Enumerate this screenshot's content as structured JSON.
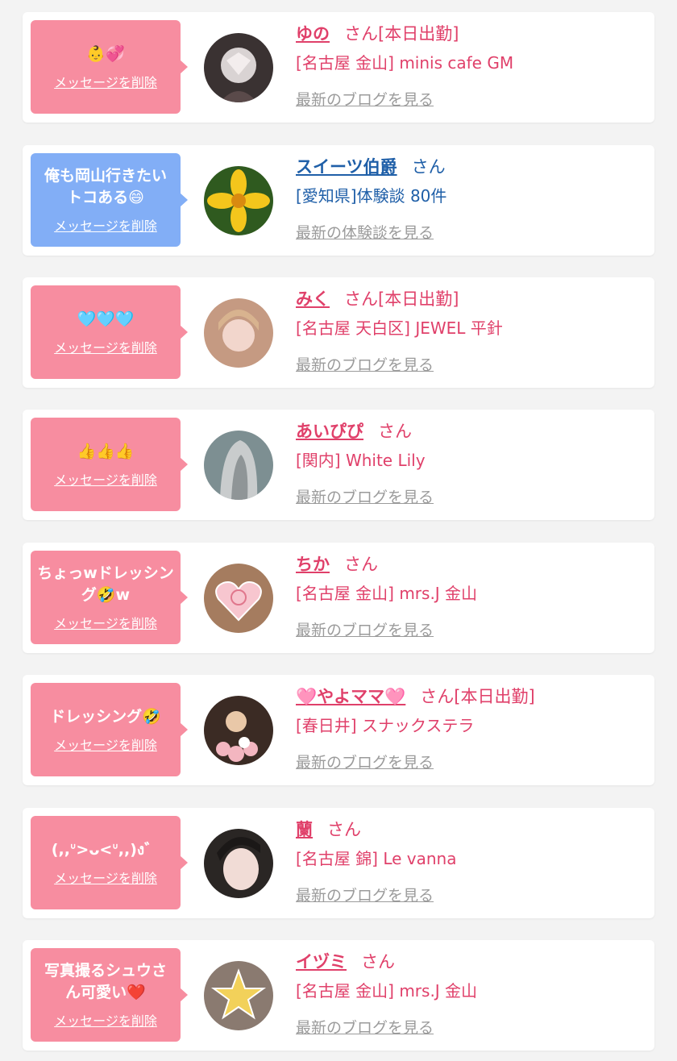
{
  "delete_label": "メッセージを削除",
  "colors": {
    "pink_bubble": "#f78da0",
    "blue_bubble": "#82aef6",
    "pink_text": "#e0406a",
    "blue_text": "#1f5fa8",
    "gray_link": "#9b9b9b"
  },
  "items": [
    {
      "message": "👶💞",
      "name": "ゆの",
      "suffix": "さん[本日出勤]",
      "shop": "[名古屋 金山] minis cafe GM",
      "link": "最新のブログを見る"
    },
    {
      "message": "俺も岡山行きたいトコある😄",
      "name": "スイーツ伯爵",
      "suffix": "さん",
      "shop": "[愛知県]体験談 80件",
      "link": "最新の体験談を見る"
    },
    {
      "message": "🩵🩵🩵",
      "name": "みく",
      "suffix": "さん[本日出勤]",
      "shop": "[名古屋 天白区] JEWEL 平針",
      "link": "最新のブログを見る"
    },
    {
      "message": "👍👍👍",
      "name": "あいぴぴ",
      "suffix": "さん",
      "shop": "[関内] White Lily",
      "link": "最新のブログを見る"
    },
    {
      "message": "ちょっwドレッシング🤣w",
      "name": "ちか",
      "suffix": "さん",
      "shop": "[名古屋 金山] mrs.J 金山",
      "link": "最新のブログを見る"
    },
    {
      "message": "ドレッシング🤣",
      "name": "🩷やよママ🩷",
      "suffix": "さん[本日出勤]",
      "shop": "[春日井] スナックステラ",
      "link": "最新のブログを見る"
    },
    {
      "message": "(,,ᐡ>ᴗ<ᐡ,,)ง゛",
      "name": "蘭",
      "suffix": "さん",
      "shop": "[名古屋 錦] Le vanna",
      "link": "最新のブログを見る"
    },
    {
      "message": "写真撮るシュウさん可愛い❤️",
      "name": "イヅミ",
      "suffix": "さん",
      "shop": "[名古屋 金山] mrs.J 金山",
      "link": "最新のブログを見る"
    }
  ]
}
